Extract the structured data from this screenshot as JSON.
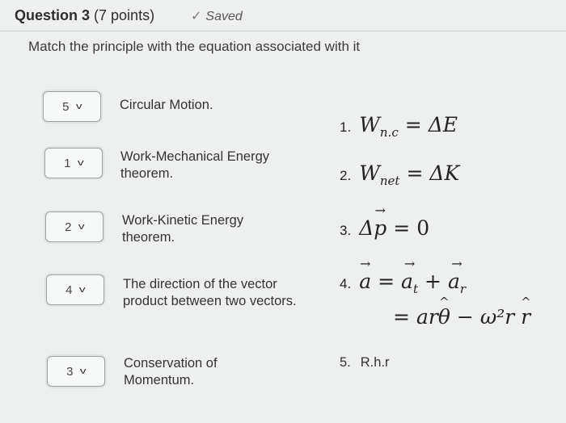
{
  "question": {
    "title": "Question 3",
    "points": "(7 points)",
    "status": "Saved",
    "prompt": "Match the principle with the equation associated with it"
  },
  "rows": [
    {
      "selected": "5",
      "label": "Circular Motion."
    },
    {
      "selected": "1",
      "label": "Work-Mechanical Energy theorem."
    },
    {
      "selected": "2",
      "label": "Work-Kinetic Energy theorem."
    },
    {
      "selected": "4",
      "label": "The direction of the vector product between two vectors."
    },
    {
      "selected": "3",
      "label": "Conservation of Momentum."
    }
  ],
  "equations": {
    "1": {
      "num": "1.",
      "text": "W_n.c = ΔE"
    },
    "2": {
      "num": "2.",
      "text": "W_net = ΔK"
    },
    "3": {
      "num": "3.",
      "text": "Δp⃗ = 0"
    },
    "4": {
      "num": "4.",
      "text": "a⃗ = a⃗_t + a⃗_r = arθ̂ − ω²r r̂"
    },
    "5": {
      "num": "5.",
      "text": "R.h.r"
    }
  },
  "colors": {
    "background": "#eef0f0",
    "text": "#2d2d2d",
    "border": "#9ea3a5"
  },
  "icons": {
    "saved": "check-icon",
    "select": "chevron-down-icon"
  }
}
